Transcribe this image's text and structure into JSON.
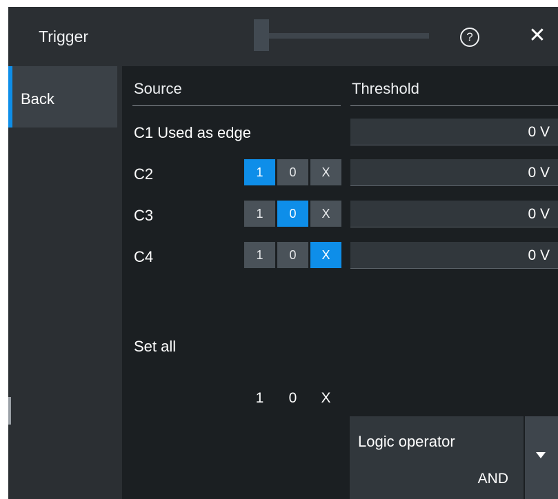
{
  "window": {
    "title": "Trigger"
  },
  "titlebar": {
    "help_glyph": "?",
    "close_glyph": "✕"
  },
  "nav": {
    "back_label": "Back"
  },
  "headers": {
    "source": "Source",
    "threshold": "Threshold"
  },
  "rows": [
    {
      "label": "C1 Used as edge",
      "threshold": "0 V"
    },
    {
      "label": "C2",
      "threshold": "0 V",
      "state": "1",
      "buttons": [
        "1",
        "0",
        "X"
      ]
    },
    {
      "label": "C3",
      "threshold": "0 V",
      "state": "0",
      "buttons": [
        "1",
        "0",
        "X"
      ]
    },
    {
      "label": "C4",
      "threshold": "0 V",
      "state": "X",
      "buttons": [
        "1",
        "0",
        "X"
      ]
    }
  ],
  "set_all": {
    "label": "Set all",
    "buttons": [
      "1",
      "0",
      "X"
    ]
  },
  "logic": {
    "label": "Logic operator",
    "value": "AND"
  },
  "colors": {
    "accent": "#0e8ee9",
    "background": "#1b1f22",
    "titlebar": "#2b2f33"
  },
  "icons": {
    "help": "help-circle-icon",
    "close": "close-icon",
    "dropdown": "chevron-down-icon"
  }
}
